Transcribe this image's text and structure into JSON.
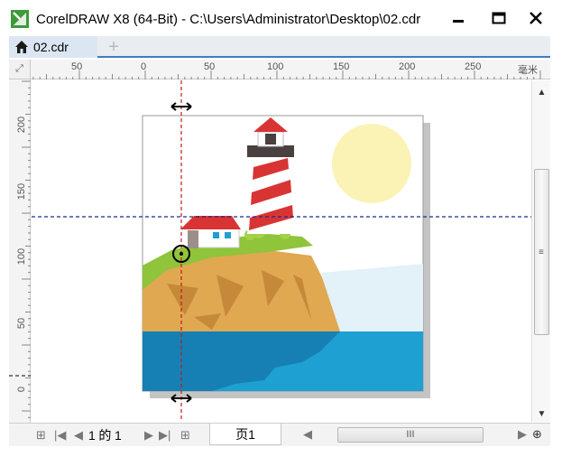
{
  "window": {
    "title": "CorelDRAW X8 (64-Bit) - C:\\Users\\Administrator\\Desktop\\02.cdr",
    "minimize_icon": "minimize-icon",
    "maximize_icon": "maximize-icon",
    "close_icon": "close-icon"
  },
  "tabs": {
    "doc_tab_label": "02.cdr",
    "add_tab_symbol": "+"
  },
  "ruler": {
    "corner_symbol": "⤢",
    "unit": "毫米",
    "h_ticks": [
      "50",
      "0",
      "50",
      "100",
      "150",
      "200",
      "250"
    ],
    "v_ticks": [
      "200",
      "150",
      "100",
      "50",
      "0"
    ]
  },
  "page_nav": {
    "page_current": "1",
    "of": "的",
    "page_total": "1",
    "page_tab_label": "页1"
  },
  "hscroll": {
    "grip": "III"
  },
  "vscroll": {
    "grip": "≡"
  },
  "colors": {
    "sky_sun": "#fbf2b6",
    "lighthouse_red": "#d93434",
    "grass": "#8fc43b",
    "cliff": "#e0a851",
    "sea": "#1ea0d2",
    "guide_blue": "#1b2a8a",
    "guide_red": "#c41a1a"
  }
}
